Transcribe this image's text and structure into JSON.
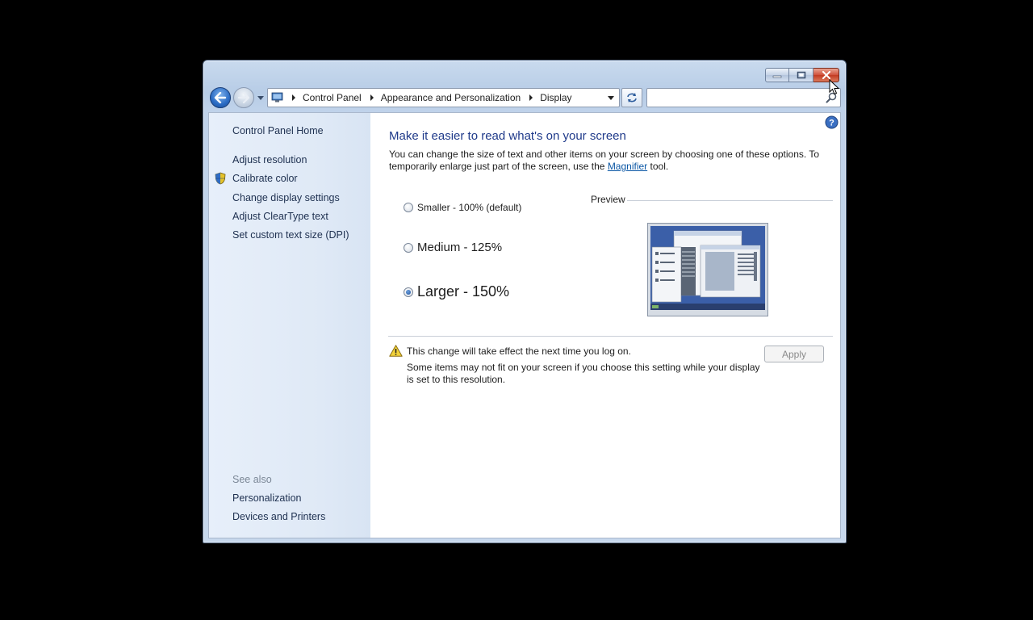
{
  "window": {
    "caption": {
      "minimize_icon": "minimize-icon",
      "maximize_icon": "maximize-icon",
      "close_icon": "close-icon"
    }
  },
  "address": {
    "breadcrumbs": [
      "Control Panel",
      "Appearance and Personalization",
      "Display"
    ]
  },
  "search": {
    "value": "",
    "placeholder": ""
  },
  "left_pane": {
    "home": "Control Panel Home",
    "tasks": [
      "Adjust resolution",
      "Calibrate color",
      "Change display settings",
      "Adjust ClearType text",
      "Set custom text size (DPI)"
    ],
    "see_also_label": "See also",
    "see_also": [
      "Personalization",
      "Devices and Printers"
    ]
  },
  "main": {
    "title": "Make it easier to read what's on your screen",
    "desc_before": "You can change the size of text and other items on your screen by choosing one of these options. To temporarily enlarge just part of the screen, use the ",
    "desc_link": "Magnifier",
    "desc_after": " tool.",
    "options": [
      {
        "label": "Smaller - 100% (default)",
        "checked": false
      },
      {
        "label": "Medium - 125%",
        "checked": false
      },
      {
        "label": "Larger - 150%",
        "checked": true
      }
    ],
    "preview_label": "Preview",
    "warning_line1": "This change will take effect the next time you log on.",
    "warning_line2": "Some items may not fit on your screen if you choose this setting while your display is set to this resolution.",
    "apply_label": "Apply"
  },
  "colors": {
    "title": "#1f3a8a",
    "link": "#0b57a5",
    "close_button": "#c23a22"
  }
}
